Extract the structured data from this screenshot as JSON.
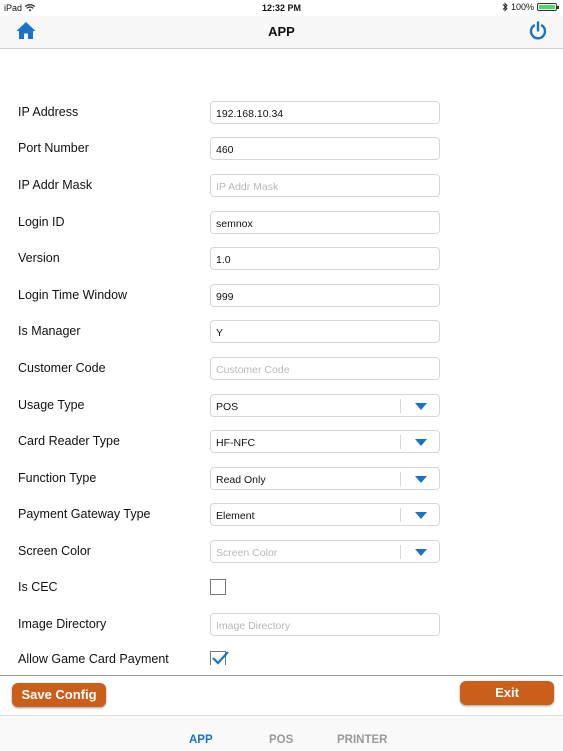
{
  "status_bar": {
    "device": "iPad",
    "time": "12:32 PM",
    "battery_text": "100%",
    "battery_level": 1.0
  },
  "navbar": {
    "title": "APP",
    "accent_color": "#1a73c8"
  },
  "form": {
    "rows": [
      {
        "label": "IP Address",
        "value": "192.168.10.34",
        "placeholder": ""
      },
      {
        "label": "Port Number",
        "value": "460",
        "placeholder": ""
      },
      {
        "label": "IP Addr Mask",
        "value": "",
        "placeholder": "IP Addr Mask"
      },
      {
        "label": "Login ID",
        "value": "semnox",
        "placeholder": ""
      },
      {
        "label": "Version",
        "value": "1.0",
        "placeholder": ""
      },
      {
        "label": "Login Time Window",
        "value": "999",
        "placeholder": ""
      },
      {
        "label": "Is Manager",
        "value": "Y",
        "placeholder": ""
      },
      {
        "label": "Customer Code",
        "value": "",
        "placeholder": "Customer Code"
      },
      {
        "label": "Usage Type",
        "value": "POS"
      },
      {
        "label": "Card Reader Type",
        "value": "HF-NFC"
      },
      {
        "label": "Function Type",
        "value": "Read Only"
      },
      {
        "label": "Payment Gateway Type",
        "value": "Element"
      },
      {
        "label": "Screen Color",
        "value": "",
        "placeholder": "Screen Color"
      },
      {
        "label": "Is CEC",
        "checked": false
      },
      {
        "label": "Image Directory",
        "value": "",
        "placeholder": "Image Directory"
      },
      {
        "label": "Allow Game Card Payment",
        "checked": true
      }
    ]
  },
  "footer": {
    "save_label": "Save Config",
    "exit_label": "Exit",
    "button_color": "#c95f1b"
  },
  "tabs": [
    {
      "label": "APP",
      "active": true
    },
    {
      "label": "POS",
      "active": false
    },
    {
      "label": "PRINTER",
      "active": false
    }
  ]
}
